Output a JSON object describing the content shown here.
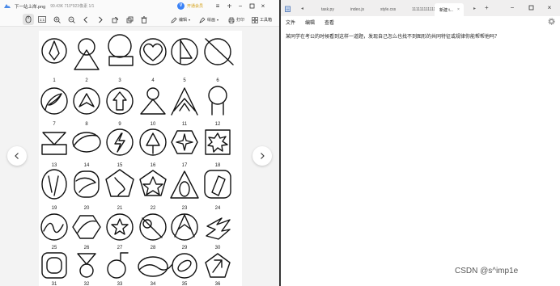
{
  "viewer": {
    "title": {
      "filename": "下一站上岸.png",
      "info": "99.43K  710*923像素  1/1",
      "badge": "V",
      "member_label": "开通会员"
    },
    "toolbar": {
      "fit_label": "1:1",
      "edit_label": "编辑",
      "draw_label": "绘画",
      "print_label": "打印",
      "tools_label": "工具箱"
    },
    "figures": [
      "1",
      "2",
      "3",
      "4",
      "5",
      "6",
      "7",
      "8",
      "9",
      "10",
      "11",
      "12",
      "13",
      "14",
      "15",
      "16",
      "17",
      "18",
      "19",
      "20",
      "21",
      "22",
      "23",
      "24",
      "25",
      "26",
      "27",
      "28",
      "29",
      "30",
      "31",
      "32",
      "33",
      "34",
      "35",
      "36"
    ]
  },
  "notepad": {
    "tabs": [
      {
        "label": "task.py"
      },
      {
        "label": "index.js"
      },
      {
        "label": "style.css"
      },
      {
        "label": "111111111111"
      },
      {
        "label": "新建 t..."
      }
    ],
    "new_tab_label": "+",
    "menu": [
      "文件",
      "编辑",
      "查看"
    ],
    "content": "某同学在考公的时候看到这样一道题，发现自己怎么也找不到图形的共同特征或规律你能帮帮他吗？"
  },
  "watermark": "CSDN @s^imp1e"
}
